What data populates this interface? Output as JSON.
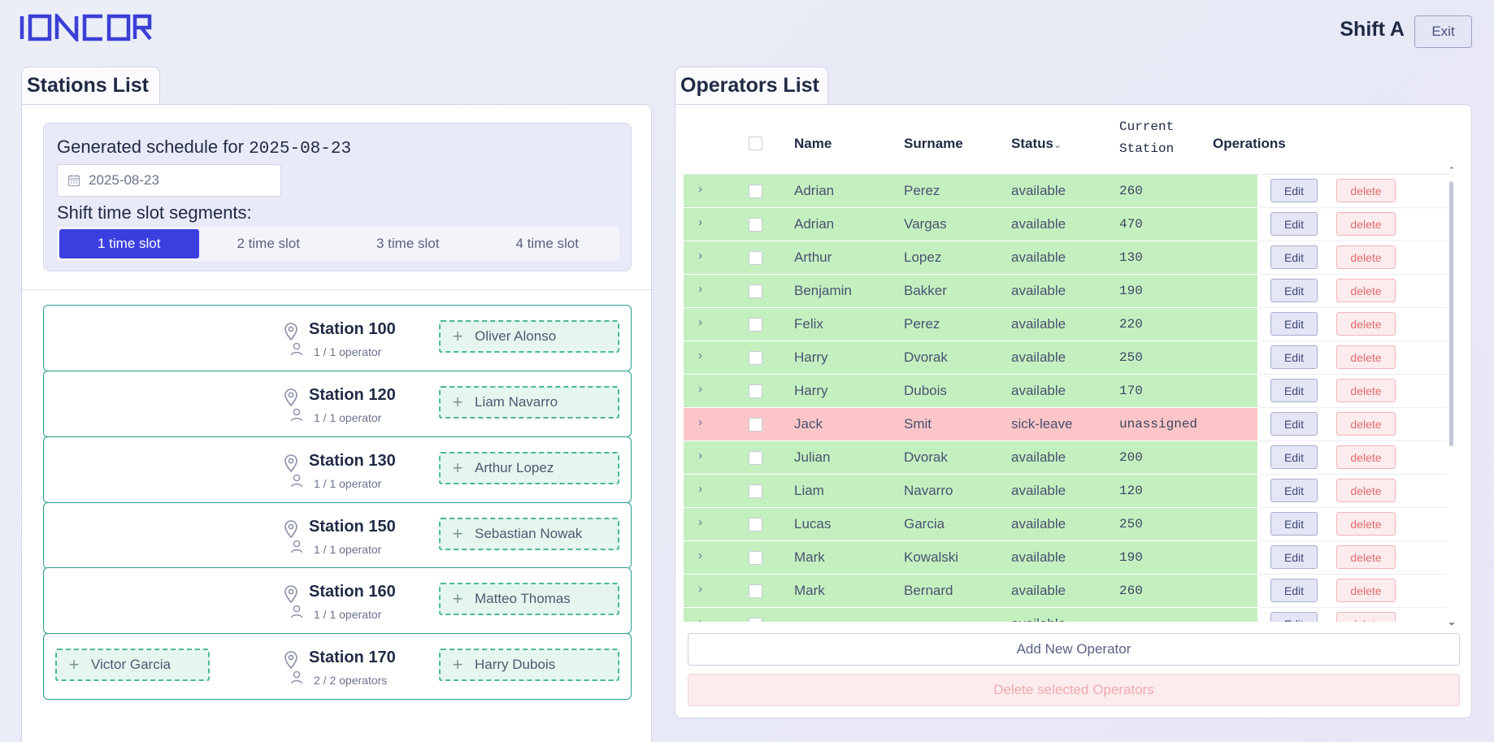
{
  "header": {
    "logo_text": "IONCOR",
    "shift_label": "Shift A",
    "exit_label": "Exit"
  },
  "stations_tab": {
    "label": "Stations List"
  },
  "schedule": {
    "title_prefix": "Generated schedule for",
    "title_date": "2025-08-23",
    "date_value": "2025-08-23",
    "segments_label": "Shift time slot segments:",
    "segments": [
      "1 time slot",
      "2 time slot",
      "3 time slot",
      "4 time slot"
    ],
    "active_segment": 0
  },
  "stations": [
    {
      "name": "Station 100",
      "count": "1 / 1 operator",
      "left_op": "",
      "right_op": "Oliver Alonso"
    },
    {
      "name": "Station 120",
      "count": "1 / 1 operator",
      "left_op": "",
      "right_op": "Liam Navarro"
    },
    {
      "name": "Station 130",
      "count": "1 / 1 operator",
      "left_op": "",
      "right_op": "Arthur Lopez"
    },
    {
      "name": "Station 150",
      "count": "1 / 1 operator",
      "left_op": "",
      "right_op": "Sebastian Nowak"
    },
    {
      "name": "Station 160",
      "count": "1 / 1 operator",
      "left_op": "",
      "right_op": "Matteo Thomas"
    },
    {
      "name": "Station 170",
      "count": "2 / 2 operators",
      "left_op": "Victor Garcia",
      "right_op": "Harry Dubois"
    }
  ],
  "operators_tab": {
    "label": "Operators List"
  },
  "operators_table": {
    "columns": {
      "name": "Name",
      "surname": "Surname",
      "status": "Status",
      "current_station_line1": "Current",
      "current_station_line2": "Station",
      "operations": "Operations"
    },
    "edit_label": "Edit",
    "delete_label": "delete",
    "rows": [
      {
        "name": "Adrian",
        "surname": "Perez",
        "status": "available",
        "station": "260"
      },
      {
        "name": "Adrian",
        "surname": "Vargas",
        "status": "available",
        "station": "470"
      },
      {
        "name": "Arthur",
        "surname": "Lopez",
        "status": "available",
        "station": "130"
      },
      {
        "name": "Benjamin",
        "surname": "Bakker",
        "status": "available",
        "station": "190"
      },
      {
        "name": "Felix",
        "surname": "Perez",
        "status": "available",
        "station": "220"
      },
      {
        "name": "Harry",
        "surname": "Dvorak",
        "status": "available",
        "station": "250"
      },
      {
        "name": "Harry",
        "surname": "Dubois",
        "status": "available",
        "station": "170"
      },
      {
        "name": "Jack",
        "surname": "Smit",
        "status": "sick-leave",
        "station": "unassigned"
      },
      {
        "name": "Julian",
        "surname": "Dvorak",
        "status": "available",
        "station": "200"
      },
      {
        "name": "Liam",
        "surname": "Navarro",
        "status": "available",
        "station": "120"
      },
      {
        "name": "Lucas",
        "surname": "Garcia",
        "status": "available",
        "station": "250"
      },
      {
        "name": "Mark",
        "surname": "Kowalski",
        "status": "available",
        "station": "190"
      },
      {
        "name": "Mark",
        "surname": "Bernard",
        "status": "available",
        "station": "260"
      },
      {
        "name": "",
        "surname": "",
        "status": "available",
        "station": ""
      }
    ]
  },
  "actions": {
    "add_label": "Add New Operator",
    "delete_selected_label": "Delete selected Operators"
  },
  "colors": {
    "accent": "#3b3fe0",
    "available_row": "#c4f0c0",
    "sick_row": "#fcc6c8",
    "station_border": "#2c9f8f"
  }
}
